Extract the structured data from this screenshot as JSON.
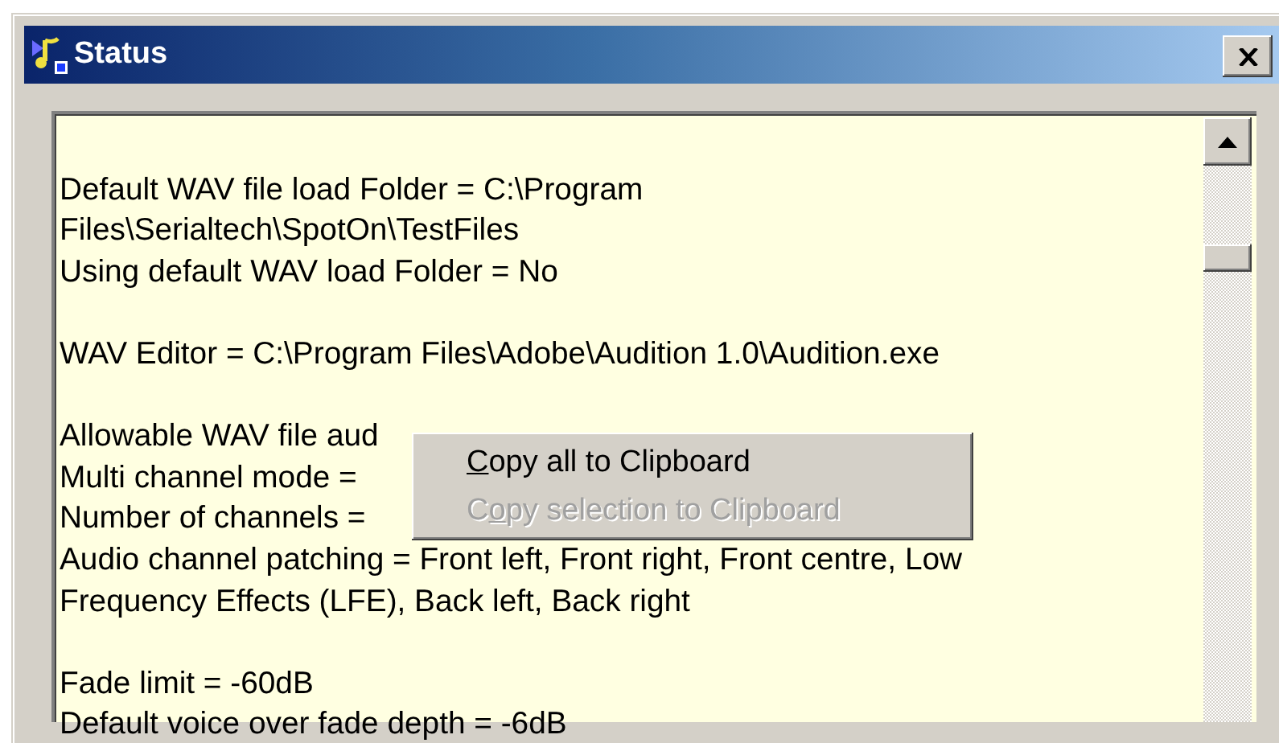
{
  "window": {
    "title": "Status"
  },
  "status_text": {
    "lines": [
      {
        "kind": "blank"
      },
      {
        "kind": "text",
        "text": "Default WAV file load Folder = C:\\Program"
      },
      {
        "kind": "text",
        "text": "Files\\Serialtech\\SpotOn\\TestFiles"
      },
      {
        "kind": "text",
        "text": "Using default WAV load Folder = No"
      },
      {
        "kind": "blank"
      },
      {
        "kind": "text",
        "text": "WAV Editor = C:\\Program Files\\Adobe\\Audition 1.0\\Audition.exe"
      },
      {
        "kind": "blank"
      },
      {
        "kind": "text",
        "text": "Allowable WAV file aud"
      },
      {
        "kind": "text",
        "text": "Multi channel mode ="
      },
      {
        "kind": "text",
        "text": "Number of channels ="
      },
      {
        "kind": "text",
        "text": "Audio channel patching = Front left, Front right, Front centre, Low"
      },
      {
        "kind": "text",
        "text": "Frequency Effects (LFE), Back left, Back right"
      },
      {
        "kind": "blank"
      },
      {
        "kind": "text",
        "text": "Fade limit = -60dB"
      },
      {
        "kind": "text",
        "text": "Default voice over fade depth = -6dB"
      }
    ]
  },
  "context_menu": {
    "items": [
      {
        "key": "C",
        "rest": "opy all to Clipboard",
        "disabled": false
      },
      {
        "lead": "C",
        "key": "o",
        "rest": "py selection to Clipboard",
        "disabled": true
      }
    ]
  }
}
